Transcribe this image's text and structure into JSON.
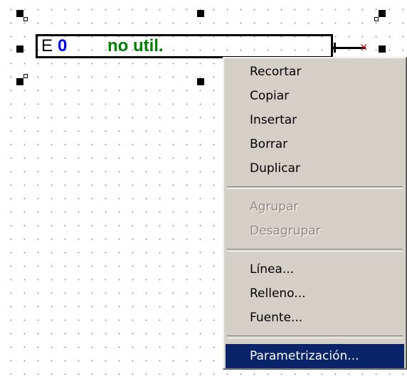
{
  "block": {
    "type": "E",
    "number": "0",
    "label": "no util."
  },
  "connector": {
    "marker": "×"
  },
  "context_menu": {
    "group1": [
      {
        "label": "Recortar",
        "enabled": true
      },
      {
        "label": "Copiar",
        "enabled": true
      },
      {
        "label": "Insertar",
        "enabled": true
      },
      {
        "label": "Borrar",
        "enabled": true
      },
      {
        "label": "Duplicar",
        "enabled": true
      }
    ],
    "group2": [
      {
        "label": "Agrupar",
        "enabled": false
      },
      {
        "label": "Desagrupar",
        "enabled": false
      }
    ],
    "group3": [
      {
        "label": "Línea...",
        "enabled": true
      },
      {
        "label": "Relleno...",
        "enabled": true
      },
      {
        "label": "Fuente...",
        "enabled": true
      }
    ],
    "group4": [
      {
        "label": "Parametrización...",
        "enabled": true,
        "highlighted": true
      }
    ]
  },
  "colors": {
    "block_number": "#0000ff",
    "block_label": "#008000",
    "connector_marker": "#e00000",
    "menu_background": "#d4d0c8",
    "menu_highlight": "#0a246a"
  }
}
